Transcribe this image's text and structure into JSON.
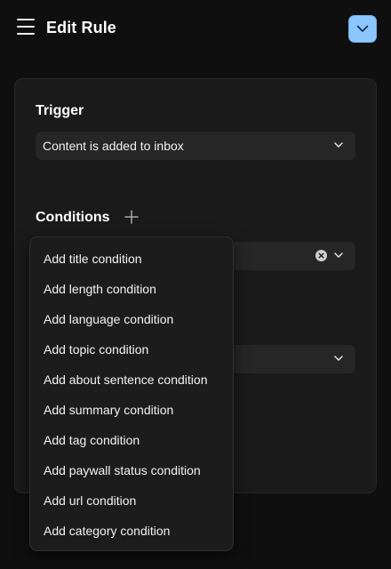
{
  "header": {
    "title": "Edit Rule",
    "menu_icon": "hamburger-menu-icon",
    "action_icon": "chevron-down-icon",
    "action_color": "#8cc6ff"
  },
  "trigger": {
    "label": "Trigger",
    "selected": "Content is added to inbox"
  },
  "conditions": {
    "label": "Conditions",
    "add_icon": "plus-icon"
  },
  "menu": {
    "items": [
      "Add title condition",
      "Add length condition",
      "Add language condition",
      "Add topic condition",
      "Add about sentence condition",
      "Add summary condition",
      "Add tag condition",
      "Add paywall status condition",
      "Add url condition",
      "Add category condition"
    ]
  }
}
